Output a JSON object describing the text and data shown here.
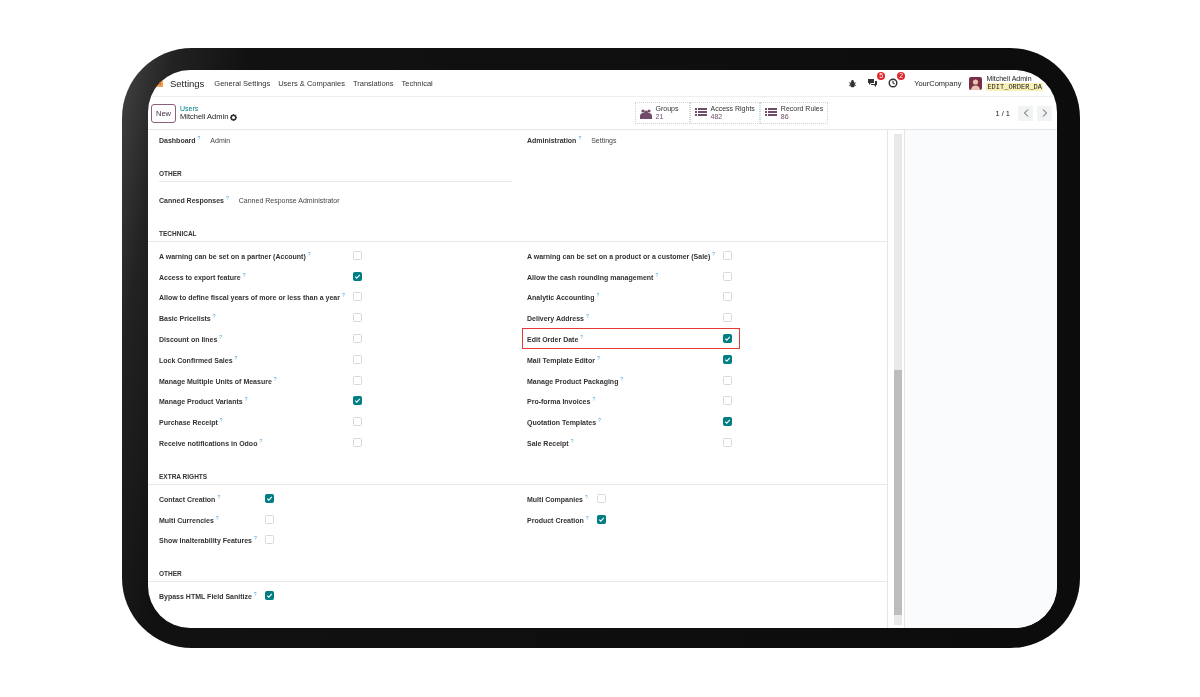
{
  "navbar": {
    "app": "Settings",
    "menu": [
      "General Settings",
      "Users & Companies",
      "Translations",
      "Technical"
    ],
    "messages_badge": "5",
    "activities_badge": "2",
    "company": "YourCompany",
    "user": {
      "name": "Mitchell Admin",
      "database": "EDIT_ORDER_DA"
    }
  },
  "control_panel": {
    "new_button": "New",
    "breadcrumb": {
      "parent": "Users",
      "current": "Mitchell Admin"
    },
    "stats": [
      {
        "kind": "groups",
        "label": "Groups",
        "value": "21"
      },
      {
        "kind": "list",
        "label": "Access Rights",
        "value": "482"
      },
      {
        "kind": "list",
        "label": "Record Rules",
        "value": "86"
      }
    ],
    "pager": "1 / 1"
  },
  "sections": [
    {
      "kind": "fields",
      "columns": [
        [
          {
            "label": "Dashboard$^{?}$",
            "value": "Admin"
          }
        ],
        [
          {
            "label": "Administration$^{?}$",
            "value": "Settings"
          }
        ]
      ]
    },
    {
      "kind": "fields",
      "title": "OTHER",
      "columns": [
        [
          {
            "label": "Canned Responses$^{?}$",
            "value": "Canned Response Administrator"
          }
        ]
      ]
    },
    {
      "kind": "checks",
      "title": "TECHNICAL",
      "columns": [
        [
          {
            "label": "A warning can be set on a partner (Account)$^{?}$",
            "checked": false,
            "highlighted": false
          },
          {
            "label": "Access to export feature$^{?}$",
            "checked": true,
            "highlighted": false
          },
          {
            "label": "Allow to define fiscal years of more or less than a year$^{?}$",
            "checked": false,
            "highlighted": false
          },
          {
            "label": "Basic Pricelists$^{?}$",
            "checked": false,
            "highlighted": false
          },
          {
            "label": "Discount on lines$^{?}$",
            "checked": false,
            "highlighted": false
          },
          {
            "label": "Lock Confirmed Sales$^{?}$",
            "checked": false,
            "highlighted": false
          },
          {
            "label": "Manage Multiple Units of Measure$^{?}$",
            "checked": false,
            "highlighted": false
          },
          {
            "label": "Manage Product Variants$^{?}$",
            "checked": true,
            "highlighted": false
          },
          {
            "label": "Purchase Receipt$^{?}$",
            "checked": false,
            "highlighted": false
          },
          {
            "label": "Receive notifications in Odoo$^{?}$",
            "checked": false,
            "highlighted": false
          }
        ],
        [
          {
            "label": "A warning can be set on a product or a customer (Sale)$^{?}$",
            "checked": false,
            "highlighted": false
          },
          {
            "label": "Allow the cash rounding management$^{?}$",
            "checked": false,
            "highlighted": false
          },
          {
            "label": "Analytic Accounting$^{?}$",
            "checked": false,
            "highlighted": false
          },
          {
            "label": "Delivery Address$^{?}$",
            "checked": false,
            "highlighted": false
          },
          {
            "label": "Edit Order Date$^{?}$",
            "checked": true,
            "highlighted": true
          },
          {
            "label": "Mail Template Editor$^{?}$",
            "checked": true,
            "highlighted": false
          },
          {
            "label": "Manage Product Packaging$^{?}$",
            "checked": false,
            "highlighted": false
          },
          {
            "label": "Pro-forma Invoices$^{?}$",
            "checked": false,
            "highlighted": false
          },
          {
            "label": "Quotation Templates$^{?}$",
            "checked": true,
            "highlighted": false
          },
          {
            "label": "Sale Receipt$^{?}$",
            "checked": false,
            "highlighted": false
          }
        ]
      ]
    },
    {
      "kind": "checks",
      "title": "EXTRA RIGHTS",
      "columns": [
        [
          {
            "label": "Contact Creation$^{?}$",
            "checked": true,
            "highlighted": false
          },
          {
            "label": "Multi Currencies$^{?}$",
            "checked": false,
            "highlighted": false
          },
          {
            "label": "Show Inalterability Features$^{?}$",
            "checked": false,
            "highlighted": false
          }
        ],
        [
          {
            "label": "Multi Companies$^{?}$",
            "checked": false,
            "highlighted": false
          },
          {
            "label": "Product Creation$^{?}$",
            "checked": true,
            "highlighted": false
          }
        ]
      ]
    },
    {
      "kind": "checks",
      "title": "OTHER",
      "columns": [
        [
          {
            "label": "Bypass HTML Field Sanitize$^{?}$",
            "checked": true,
            "highlighted": false
          }
        ]
      ]
    }
  ]
}
